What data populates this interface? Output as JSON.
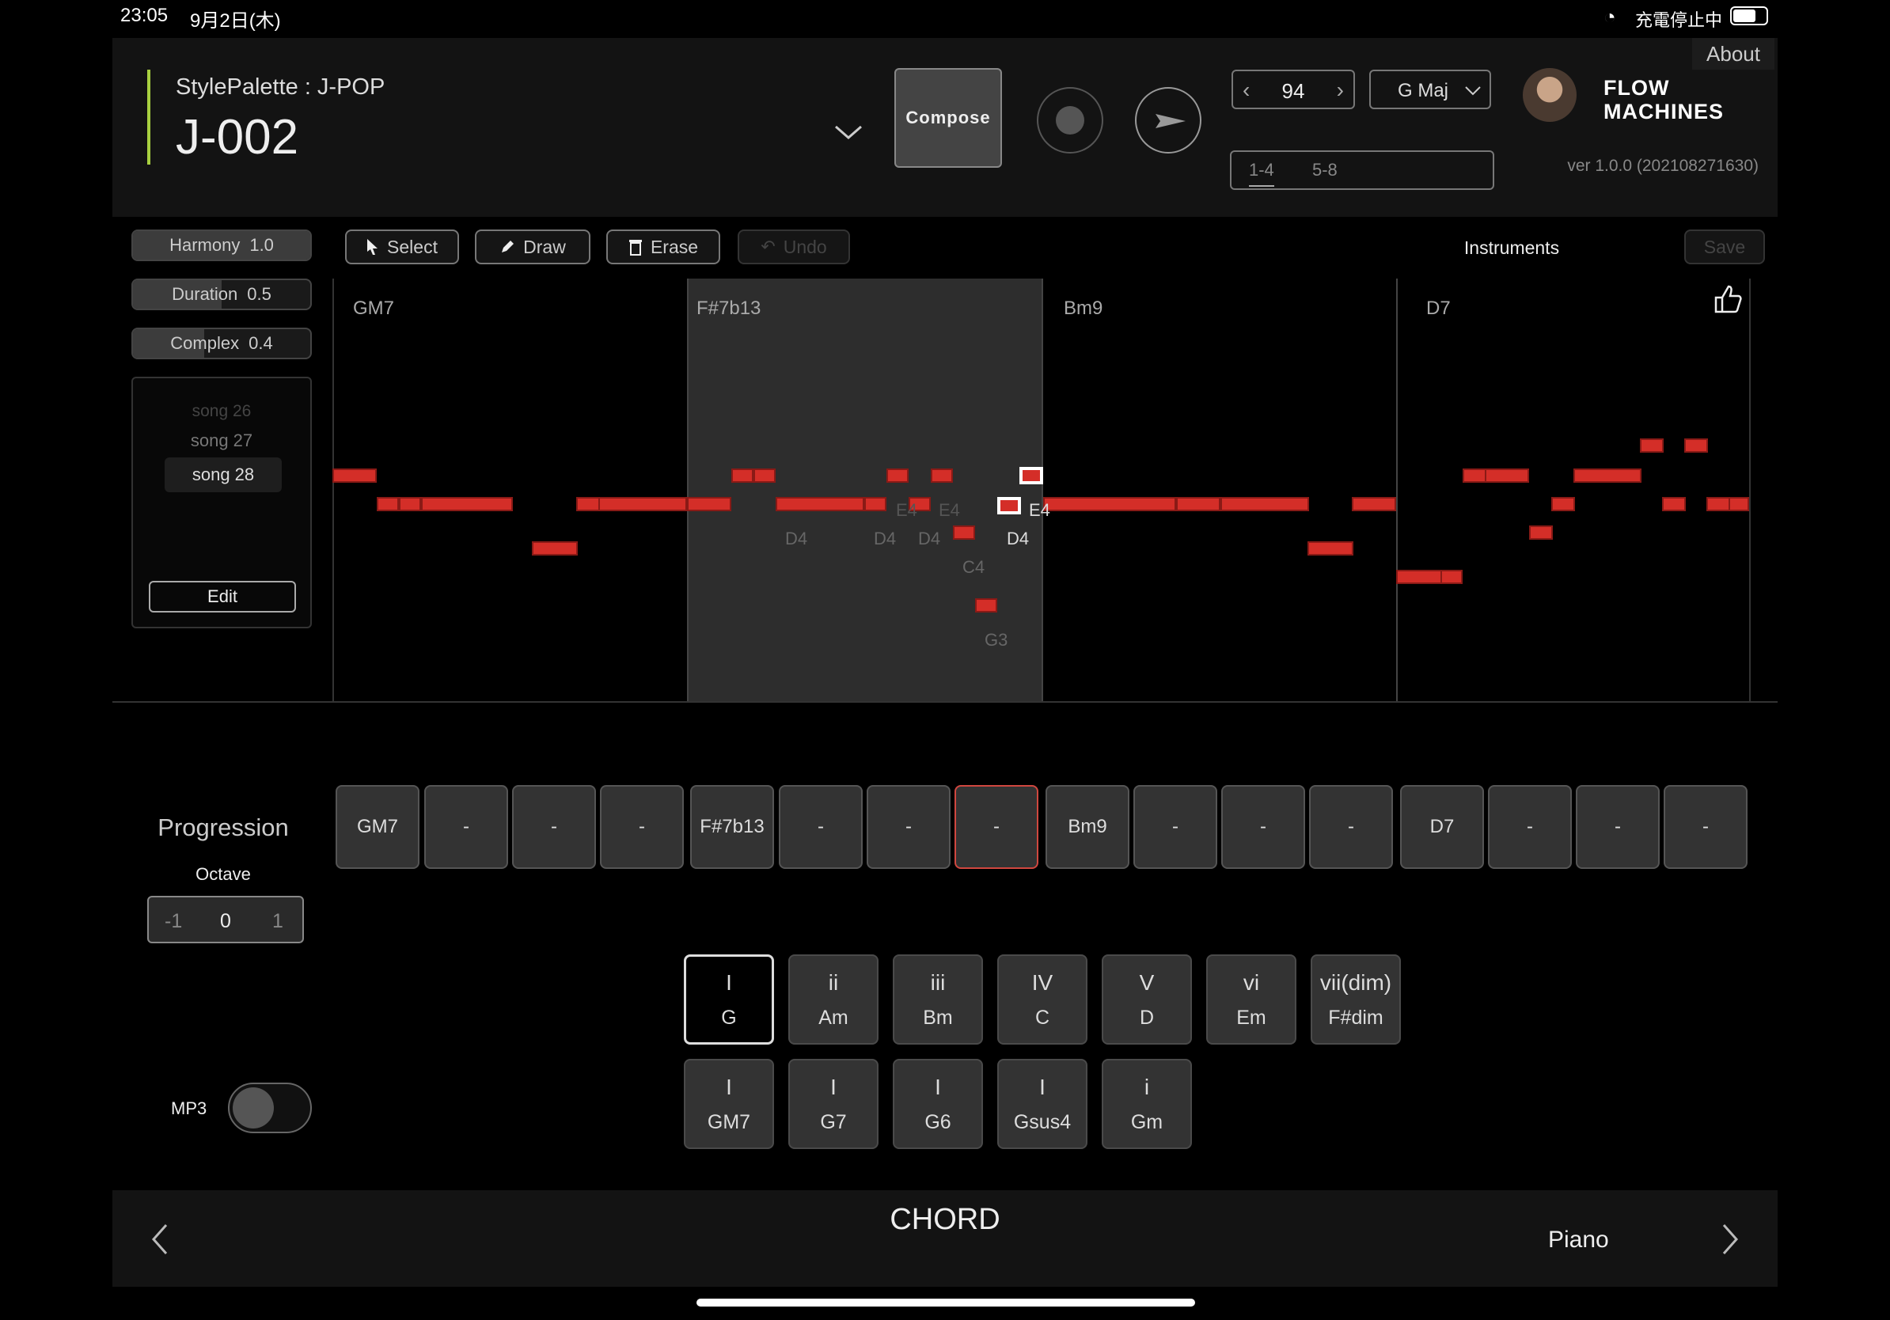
{
  "status": {
    "time": "23:05",
    "date": "9月2日(木)",
    "charge": "充電停止中"
  },
  "header": {
    "style_palette": "StylePalette : J-POP",
    "song_id": "J-002",
    "compose_label": "Compose",
    "tempo": "94",
    "key": "G Maj",
    "bars": [
      "1-4",
      "5-8"
    ],
    "about": "About",
    "version": "ver 1.0.0 (202108271630)",
    "logo": "FLOW MACHINES"
  },
  "sliders": [
    {
      "name": "Harmony",
      "value": "1.0",
      "fill": 1.0
    },
    {
      "name": "Duration",
      "value": "0.5",
      "fill": 0.5
    },
    {
      "name": "Complex",
      "value": "0.4",
      "fill": 0.4
    }
  ],
  "songs": {
    "items": [
      "song 26",
      "song 27",
      "song 28"
    ],
    "selected": "song 28",
    "edit_label": "Edit"
  },
  "tools": {
    "select": "Select",
    "draw": "Draw",
    "erase": "Erase",
    "undo": "Undo",
    "instruments": "Instruments",
    "save": "Save"
  },
  "piano_roll": {
    "chords": [
      "GM7",
      "F#7b13",
      "Bm9",
      "D7"
    ],
    "note_labels": [
      "D4",
      "D4",
      "D4",
      "E4",
      "E4",
      "D4",
      "E4",
      "C4",
      "G3"
    ]
  },
  "progression": {
    "title": "Progression",
    "octave_label": "Octave",
    "octave_values": [
      "-1",
      "0",
      "1"
    ],
    "cells": [
      "GM7",
      "-",
      "-",
      "-",
      "F#7b13",
      "-",
      "-",
      "-",
      "Bm9",
      "-",
      "-",
      "-",
      "D7",
      "-",
      "-",
      "-"
    ],
    "active_index": 7
  },
  "chord_buttons": {
    "row1": [
      {
        "numeral": "I",
        "chord": "G"
      },
      {
        "numeral": "ii",
        "chord": "Am"
      },
      {
        "numeral": "iii",
        "chord": "Bm"
      },
      {
        "numeral": "IV",
        "chord": "C"
      },
      {
        "numeral": "V",
        "chord": "D"
      },
      {
        "numeral": "vi",
        "chord": "Em"
      },
      {
        "numeral": "vii(dim)",
        "chord": "F#dim"
      }
    ],
    "row2": [
      {
        "numeral": "I",
        "chord": "GM7"
      },
      {
        "numeral": "I",
        "chord": "G7"
      },
      {
        "numeral": "I",
        "chord": "G6"
      },
      {
        "numeral": "I",
        "chord": "Gsus4"
      },
      {
        "numeral": "i",
        "chord": "Gm"
      }
    ]
  },
  "mp3_label": "MP3",
  "footer": {
    "mode": "CHORD",
    "instrument": "Piano"
  },
  "colors": {
    "accent_bar": "#a8d040",
    "note": "#d42e28",
    "active_cell": "#d0473f"
  }
}
